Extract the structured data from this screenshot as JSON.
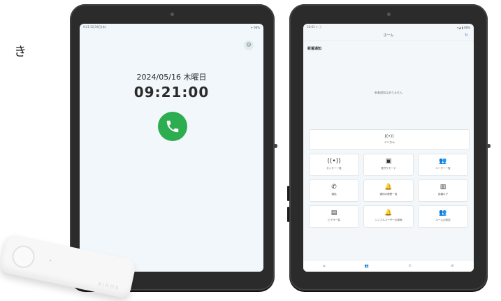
{
  "edge_text": "き",
  "tablet1": {
    "status_left": "9:21 5月16日(木)",
    "status_right": "✦ 98%",
    "settings_icon": "gear-icon",
    "date": "2024/05/16 木曜日",
    "time": "09:21:00",
    "call_icon": "phone-icon",
    "call_color": "#2cad4f"
  },
  "tablet2": {
    "status_left": "10:01 ✦ ⓘ",
    "status_right": "▾◢ ▮ 88%",
    "header_title": "ホーム",
    "notifications_title": "新着通知",
    "notifications_empty": "新着通知はありません",
    "intercom_label": "インカム",
    "tiles": [
      {
        "icon": "broadcast-icon",
        "glyph": "((•))",
        "label": "センサー一覧"
      },
      {
        "icon": "monitor-icon",
        "glyph": "▣",
        "label": "見守りモード"
      },
      {
        "icon": "users-icon",
        "glyph": "👥",
        "label": "ユーザー一覧"
      },
      {
        "icon": "phone-icon",
        "glyph": "✆",
        "label": "通話"
      },
      {
        "icon": "bell-icon",
        "glyph": "🔔",
        "label": "通知の履歴一覧"
      },
      {
        "icon": "log-icon",
        "glyph": "▥",
        "label": "各種ログ"
      },
      {
        "icon": "report-icon",
        "glyph": "▤",
        "label": "ビデオ一覧"
      },
      {
        "icon": "bell-icon",
        "glyph": "🔔",
        "label": "シンプルユーザーの検索"
      },
      {
        "icon": "users-icon",
        "glyph": "👥",
        "label": "ルームの設定"
      }
    ],
    "nav": [
      "⌂",
      "👥",
      "✆",
      "⚙"
    ]
  },
  "device": {
    "brand": "AIROS"
  }
}
